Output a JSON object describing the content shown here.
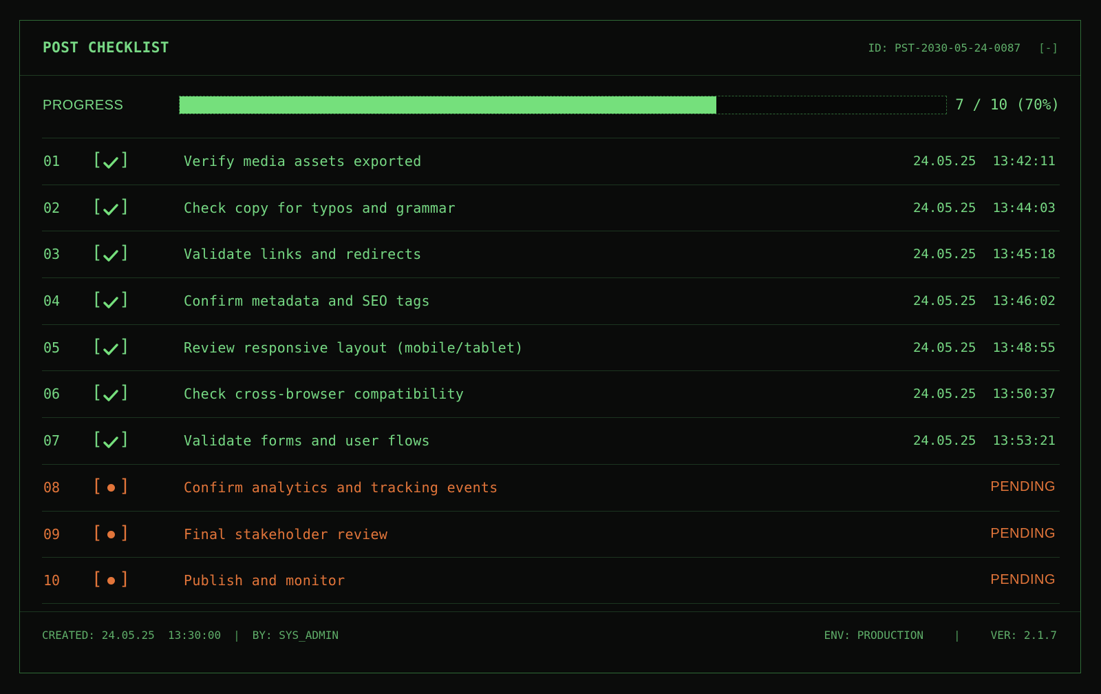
{
  "header": {
    "title": "POST CHECKLIST",
    "id_text": "ID: PST-2030-05-24-0087",
    "collapse_label": "[-]"
  },
  "progress": {
    "label": "PROGRESS",
    "completed": 7,
    "total": 10,
    "fraction": 0.7,
    "text": "7 / 10 (70%)"
  },
  "items": [
    {
      "num": "01",
      "status": "done",
      "task": "Verify media assets exported",
      "date": "24.05.25",
      "time": "13:42:11"
    },
    {
      "num": "02",
      "status": "done",
      "task": "Check copy for typos and grammar",
      "date": "24.05.25",
      "time": "13:44:03"
    },
    {
      "num": "03",
      "status": "done",
      "task": "Validate links and redirects",
      "date": "24.05.25",
      "time": "13:45:18"
    },
    {
      "num": "04",
      "status": "done",
      "task": "Confirm metadata and SEO tags",
      "date": "24.05.25",
      "time": "13:46:02"
    },
    {
      "num": "05",
      "status": "done",
      "task": "Review responsive layout (mobile/tablet)",
      "date": "24.05.25",
      "time": "13:48:55"
    },
    {
      "num": "06",
      "status": "done",
      "task": "Check cross-browser compatibility",
      "date": "24.05.25",
      "time": "13:50:37"
    },
    {
      "num": "07",
      "status": "done",
      "task": "Validate forms and user flows",
      "date": "24.05.25",
      "time": "13:53:21"
    },
    {
      "num": "08",
      "status": "pending",
      "task": "Confirm analytics and tracking events",
      "pending_label": "PENDING"
    },
    {
      "num": "09",
      "status": "pending",
      "task": "Final stakeholder review",
      "pending_label": "PENDING"
    },
    {
      "num": "10",
      "status": "pending",
      "task": "Publish and monitor",
      "pending_label": "PENDING"
    }
  ],
  "footer": {
    "created": "CREATED: 24.05.25  13:30:00",
    "by": "BY: SYS_ADMIN",
    "env": "ENV: PRODUCTION",
    "ver": "VER: 2.1.7",
    "separator": "|"
  },
  "colors": {
    "accent": "#75e07c",
    "pending": "#e2753a",
    "background": "#0a0b0a"
  },
  "icons": {
    "done": "check-icon",
    "pending": "pending-dot-icon"
  }
}
